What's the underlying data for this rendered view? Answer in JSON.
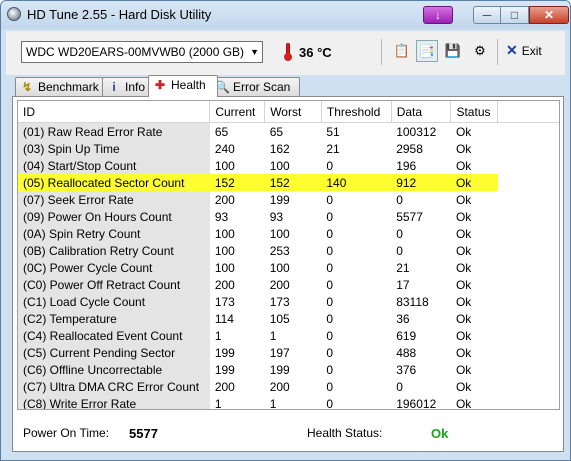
{
  "window": {
    "title": "HD Tune 2.55 - Hard Disk Utility",
    "minimize": "─",
    "maximize": "□",
    "close": "✕",
    "download": "↓"
  },
  "toolbar": {
    "drive": "WDC WD20EARS-00MVWB0 (2000 GB)",
    "temperature": "36 °C",
    "exit_label": "Exit"
  },
  "tabs": [
    {
      "label": "Benchmark",
      "icon": "gauge-icon"
    },
    {
      "label": "Info",
      "icon": "info-icon"
    },
    {
      "label": "Health",
      "icon": "health-cross-icon"
    },
    {
      "label": "Error Scan",
      "icon": "magnifier-icon"
    }
  ],
  "table": {
    "columns": [
      "ID",
      "Current",
      "Worst",
      "Threshold",
      "Data",
      "Status"
    ],
    "rows": [
      [
        "(01) Raw Read Error Rate",
        "65",
        "65",
        "51",
        "100312",
        "Ok"
      ],
      [
        "(03) Spin Up Time",
        "240",
        "162",
        "21",
        "2958",
        "Ok"
      ],
      [
        "(04) Start/Stop Count",
        "100",
        "100",
        "0",
        "196",
        "Ok"
      ],
      [
        "(05) Reallocated Sector Count",
        "152",
        "152",
        "140",
        "912",
        "Ok"
      ],
      [
        "(07) Seek Error Rate",
        "200",
        "199",
        "0",
        "0",
        "Ok"
      ],
      [
        "(09) Power On Hours Count",
        "93",
        "93",
        "0",
        "5577",
        "Ok"
      ],
      [
        "(0A) Spin Retry Count",
        "100",
        "100",
        "0",
        "0",
        "Ok"
      ],
      [
        "(0B) Calibration Retry Count",
        "100",
        "253",
        "0",
        "0",
        "Ok"
      ],
      [
        "(0C) Power Cycle Count",
        "100",
        "100",
        "0",
        "21",
        "Ok"
      ],
      [
        "(C0) Power Off Retract Count",
        "200",
        "200",
        "0",
        "17",
        "Ok"
      ],
      [
        "(C1) Load Cycle Count",
        "173",
        "173",
        "0",
        "83118",
        "Ok"
      ],
      [
        "(C2) Temperature",
        "114",
        "105",
        "0",
        "36",
        "Ok"
      ],
      [
        "(C4) Reallocated Event Count",
        "1",
        "1",
        "0",
        "619",
        "Ok"
      ],
      [
        "(C5) Current Pending Sector",
        "199",
        "197",
        "0",
        "488",
        "Ok"
      ],
      [
        "(C6) Offline Uncorrectable",
        "199",
        "199",
        "0",
        "376",
        "Ok"
      ],
      [
        "(C7) Ultra DMA CRC Error Count",
        "200",
        "200",
        "0",
        "0",
        "Ok"
      ],
      [
        "(C8) Write Error Rate",
        "1",
        "1",
        "0",
        "196012",
        "Ok"
      ]
    ],
    "highlight_color": "#ffff30"
  },
  "footer": {
    "power_on_label": "Power On Time:",
    "power_on_value": "5577",
    "health_label": "Health Status:",
    "health_value": "Ok",
    "ok_color": "#1aa51a"
  }
}
